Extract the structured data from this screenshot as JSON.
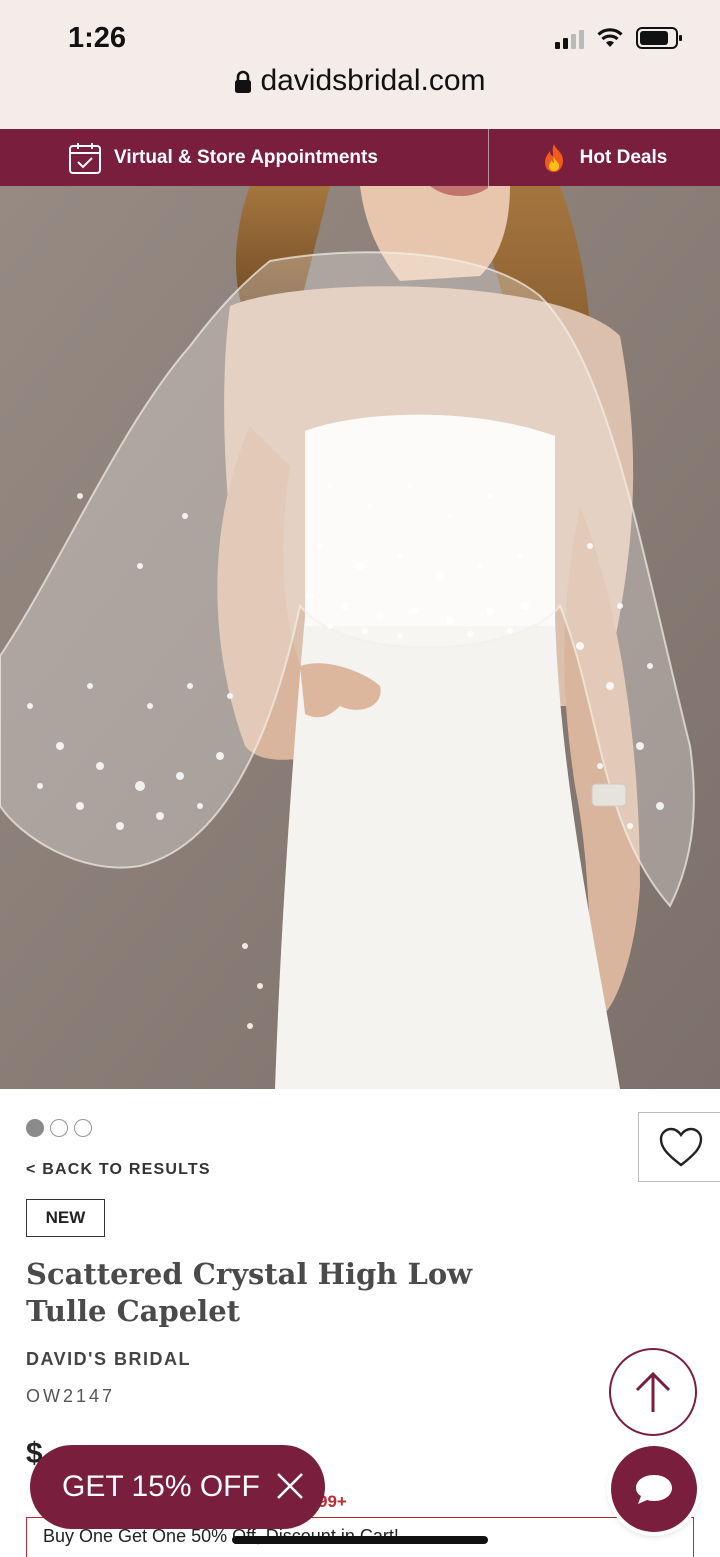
{
  "status": {
    "time": "1:26"
  },
  "browser": {
    "url": "davidsbridal.com"
  },
  "promo": {
    "appointments": "Virtual & Store Appointments",
    "deals": "Hot Deals"
  },
  "hero": {
    "image_alt": "Model wearing sheer crystal-scattered tulle capelet over white strapless gown"
  },
  "product": {
    "back_link": "< BACK TO RESULTS",
    "badge": "NEW",
    "title": "Scattered Crystal High Low Tulle Capelet",
    "brand": "DAVID'S BRIDAL",
    "sku": "OW2147",
    "price_visible": "$",
    "sale_visible": "99+",
    "offer": "Buy One Get One 50% Off, Discount in Cart!"
  },
  "popup": {
    "discount_label": "GET 15% OFF"
  },
  "colors": {
    "brand": "#7a1e3e",
    "sale": "#c0292c"
  }
}
